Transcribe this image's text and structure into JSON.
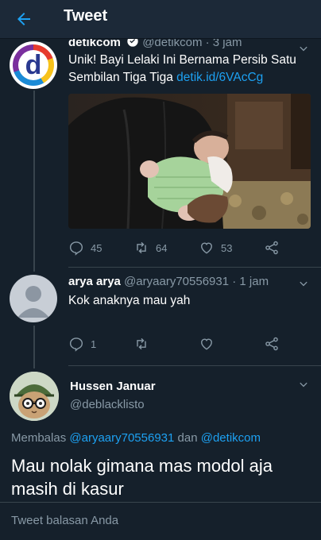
{
  "header": {
    "title": "Tweet"
  },
  "tweets": [
    {
      "display_name": "detikcom",
      "handle": "@detikcom",
      "separator": "·",
      "time": "3 jam",
      "text": "Unik! Bayi Lelaki Ini Bernama Persib Satu Sembilan Tiga Tiga",
      "link": "detik.id/6VAcCg",
      "media_icon": "baby-photo",
      "actions": {
        "reply": "45",
        "retweet": "64",
        "like": "53"
      }
    },
    {
      "display_name": "arya arya",
      "handle": "@aryaary70556931",
      "separator": "·",
      "time": "1 jam",
      "text": "Kok anaknya mau yah",
      "actions": {
        "reply": "1",
        "retweet": "",
        "like": ""
      }
    }
  ],
  "focused": {
    "display_name": "Hussen Januar",
    "handle": "@deblacklisto",
    "replying_prefix": "Membalas",
    "replying_to_1": "@aryaary70556931",
    "replying_and": "dan",
    "replying_to_2": "@detikcom",
    "text": "Mau nolak gimana mas modol aja masih di kasur"
  },
  "reply": {
    "placeholder": "Tweet balasan Anda"
  },
  "colors": {
    "background": "#15202b",
    "accent": "#1da1f2",
    "muted": "#8899a6"
  }
}
